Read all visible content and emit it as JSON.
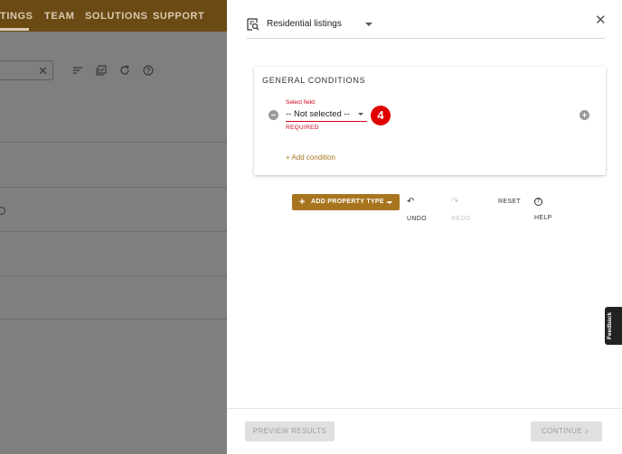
{
  "background": {
    "nav": [
      "TINGS",
      "TEAM",
      "SOLUTIONS",
      "SUPPORT"
    ],
    "search_clear": "✕"
  },
  "panel": {
    "title": "Residential listings",
    "close": "✕",
    "conditions": {
      "heading": "GENERAL CONDITIONS",
      "field_label": "Select field:",
      "field_value": "-- Not selected --",
      "required": "REQUIRED",
      "step_number": "4",
      "add_condition": "+ Add condition"
    },
    "toolbar": {
      "add_property": "ADD PROPERTY TYPE ...",
      "undo": "UNDO",
      "redo": "REDO",
      "reset": "RESET",
      "help": "HELP"
    },
    "footer": {
      "preview": "PREVIEW RESULTS",
      "continue": "CONTINUE"
    }
  },
  "feedback": "Feedback",
  "colors": {
    "accent": "#a8751f",
    "error": "#d0021b",
    "badge": "#e00000",
    "topbar": "#6b4a14"
  }
}
